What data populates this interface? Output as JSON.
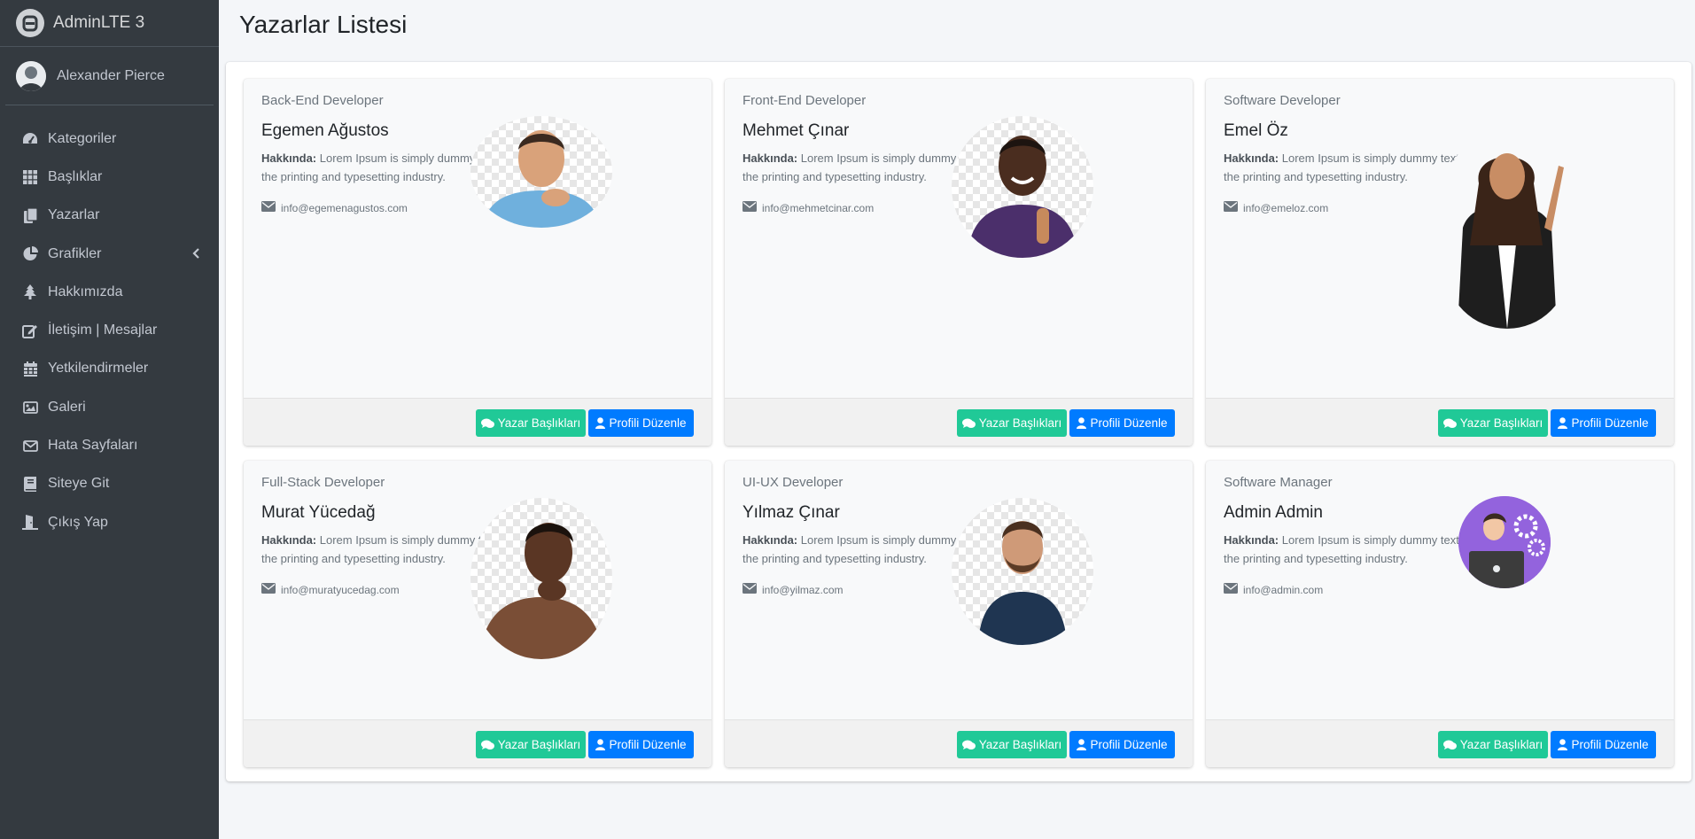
{
  "brand": {
    "title": "AdminLTE 3"
  },
  "user": {
    "name": "Alexander Pierce"
  },
  "sidebar": {
    "items": [
      {
        "label": "Kategoriler",
        "icon": "dashboard-icon"
      },
      {
        "label": "Başlıklar",
        "icon": "grid-icon"
      },
      {
        "label": "Yazarlar",
        "icon": "copy-icon"
      },
      {
        "label": "Grafikler",
        "icon": "pie-chart-icon"
      },
      {
        "label": "Hakkımızda",
        "icon": "tree-icon"
      },
      {
        "label": "İletişim | Mesajlar",
        "icon": "edit-icon"
      },
      {
        "label": "Yetkilendirmeler",
        "icon": "calendar-icon"
      },
      {
        "label": "Galeri",
        "icon": "image-icon"
      },
      {
        "label": "Hata Sayfaları",
        "icon": "envelope-icon"
      },
      {
        "label": "Siteye Git",
        "icon": "book-icon"
      },
      {
        "label": "Çıkış Yap",
        "icon": "logout-icon"
      }
    ]
  },
  "page": {
    "title": "Yazarlar Listesi"
  },
  "cards": [
    {
      "role": "Back-End Developer",
      "name": "Egemen Ağustos",
      "about_label": "Hakkında:",
      "about_text": " Lorem Ipsum is simply dummy text of the printing and typesetting industry.",
      "email": "info@egemenagustos.com",
      "photo": "person-thinking-photo"
    },
    {
      "role": "Front-End Developer",
      "name": "Mehmet Çınar",
      "about_label": "Hakkında:",
      "about_text": " Lorem Ipsum is simply dummy text of the printing and typesetting industry.",
      "email": "info@mehmetcinar.com",
      "photo": "person-thumbs-up-photo"
    },
    {
      "role": "Software Developer",
      "name": "Emel Öz",
      "about_label": "Hakkında:",
      "about_text": " Lorem Ipsum is simply dummy text of the printing and typesetting industry.",
      "email": "info@emeloz.com",
      "photo": "person-pointing-photo"
    },
    {
      "role": "Full-Stack Developer",
      "name": "Murat Yücedağ",
      "about_label": "Hakkında:",
      "about_text": " Lorem Ipsum is simply dummy text of the printing and typesetting industry.",
      "email": "info@muratyucedag.com",
      "photo": "person-thinking-photo"
    },
    {
      "role": "UI-UX Developer",
      "name": "Yılmaz Çınar",
      "about_label": "Hakkında:",
      "about_text": " Lorem Ipsum is simply dummy text of the printing and typesetting industry.",
      "email": "info@yilmaz.com",
      "photo": "person-thinking-photo"
    },
    {
      "role": "Software Manager",
      "name": "Admin Admin",
      "about_label": "Hakkında:",
      "about_text": " Lorem Ipsum is simply dummy text of the printing and typesetting industry.",
      "email": "info@admin.com",
      "photo": "admin-avatar-illustration"
    }
  ],
  "buttons": {
    "posts_label": "Yazar Başlıkları",
    "edit_label": "Profili Düzenle"
  },
  "colors": {
    "sidebar": "#343a40",
    "success": "#20c997",
    "primary": "#007bff",
    "background": "#f4f6f9"
  }
}
